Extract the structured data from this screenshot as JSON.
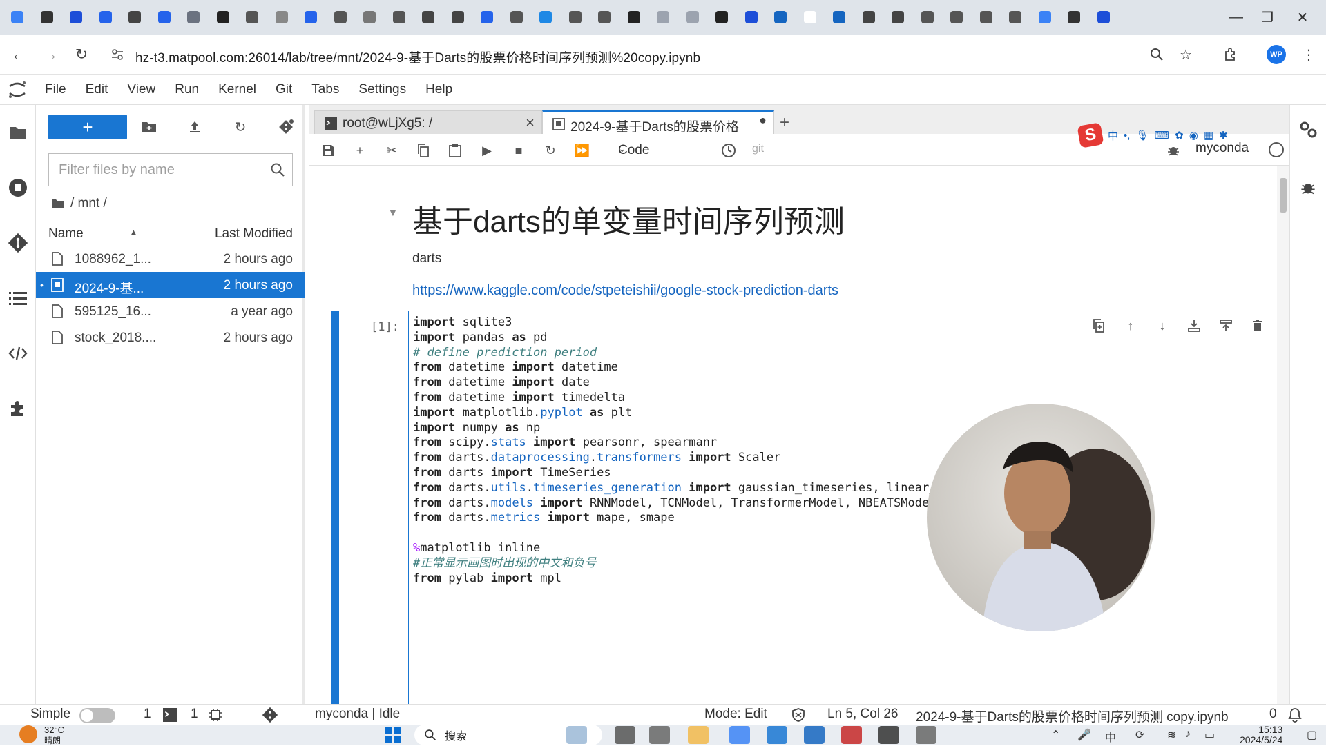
{
  "browser": {
    "url": "hz-t3.matpool.com:26014/lab/tree/mnt/2024-9-基于Darts的股票价格时间序列预测%20copy.ipynb",
    "tab_count_icons": 38,
    "profile_initials": "WP"
  },
  "menubar": {
    "items": [
      "File",
      "Edit",
      "View",
      "Run",
      "Kernel",
      "Git",
      "Tabs",
      "Settings",
      "Help"
    ]
  },
  "filebrowser": {
    "new_label": "+",
    "filter_placeholder": "Filter files by name",
    "breadcrumb": "/ mnt /",
    "col_name": "Name",
    "col_modified": "Last Modified",
    "files": [
      {
        "name": "1088962_1...",
        "modified": "2 hours ago",
        "type": "file",
        "selected": false
      },
      {
        "name": "2024-9-基...",
        "modified": "2 hours ago",
        "type": "notebook",
        "selected": true
      },
      {
        "name": "595125_16...",
        "modified": "a year ago",
        "type": "file",
        "selected": false
      },
      {
        "name": "stock_2018....",
        "modified": "2 hours ago",
        "type": "file",
        "selected": false
      }
    ]
  },
  "tabs": [
    {
      "label": "root@wLjXg5: /",
      "active": false
    },
    {
      "label": "2024-9-基于Darts的股票价格",
      "active": true
    }
  ],
  "toolbar": {
    "cell_type": "Code",
    "git_label": "git",
    "kernel_name": "myconda"
  },
  "ime": {
    "items": [
      "中",
      "•,"
    ]
  },
  "notebook": {
    "title": "基于darts的单变量时间序列预测",
    "subtitle": "darts",
    "link": "https://www.kaggle.com/code/stpeteishii/google-stock-prediction-darts",
    "prompt": "[1]:",
    "code_lines": [
      "import sqlite3",
      "import pandas as pd",
      "# define prediction period",
      "from datetime import datetime",
      "from datetime import date",
      "from datetime import timedelta",
      "import matplotlib.pyplot as plt",
      "import numpy as np",
      "from scipy.stats import pearsonr, spearmanr",
      "from darts.dataprocessing.transformers import Scaler",
      "from darts import TimeSeries",
      "from darts.utils.timeseries_generation import gaussian_timeseries, linear_timeserie",
      "from darts.models import RNNModel, TCNModel, TransformerModel, NBEATSModel, BlockRN",
      "from darts.metrics import mape, smape",
      "",
      "%matplotlib inline",
      "#正常显示画图时出现的中文和负号",
      "from pylab import mpl"
    ]
  },
  "statusbar": {
    "simple": "Simple",
    "terminals": "1",
    "kernels": "1",
    "kernel_state": "myconda | Idle",
    "mode": "Mode: Edit",
    "position": "Ln 5, Col 26",
    "filename": "2024-9-基于Darts的股票价格时间序列预测 copy.ipynb",
    "notifications": "0"
  },
  "taskbar": {
    "temperature": "32°C",
    "weather": "晴朗",
    "search_placeholder": "搜索",
    "time": "15:13",
    "date": "2024/5/24"
  }
}
